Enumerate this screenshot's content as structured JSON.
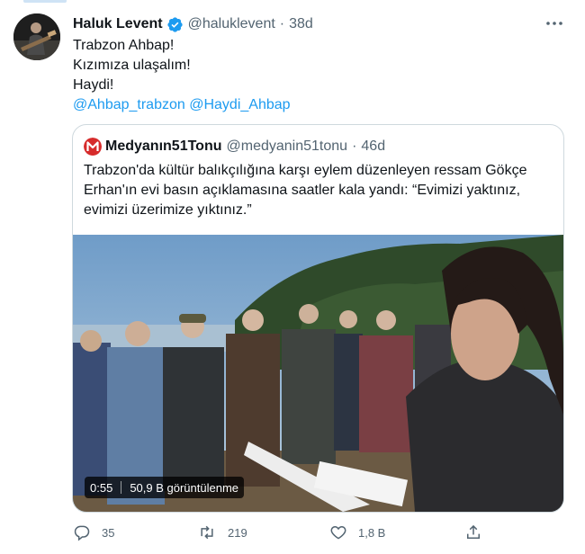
{
  "tweet": {
    "author_name": "Haluk Levent",
    "author_handle": "@haluklevent",
    "separator": "·",
    "time": "38d",
    "lines": [
      "Trabzon Ahbap!",
      "Kızımıza ulaşalım!",
      "Haydi!"
    ],
    "mentions": [
      "@Ahbap_trabzon",
      "@Haydi_Ahbap"
    ]
  },
  "quoted": {
    "author_name": "Medyanın51Tonu",
    "author_handle": "@medyanin51tonu",
    "separator": "·",
    "time": "46d",
    "text": "Trabzon'da kültür balıkçılığına karşı eylem düzenleyen ressam Gökçe Erhan'ın evi basın açıklamasına saatler kala yandı: “Evimizi yaktınız, evimizi üzerimize yıktınız.”",
    "video": {
      "duration": "0:55",
      "views": "50,9 B görüntülenme"
    }
  },
  "actions": {
    "replies": "35",
    "retweets": "219",
    "likes": "1,8 B"
  },
  "colors": {
    "link": "#1d9bf0",
    "verified": "#1d9bf0",
    "secondary": "#536471",
    "logo": "#d62b2b"
  }
}
